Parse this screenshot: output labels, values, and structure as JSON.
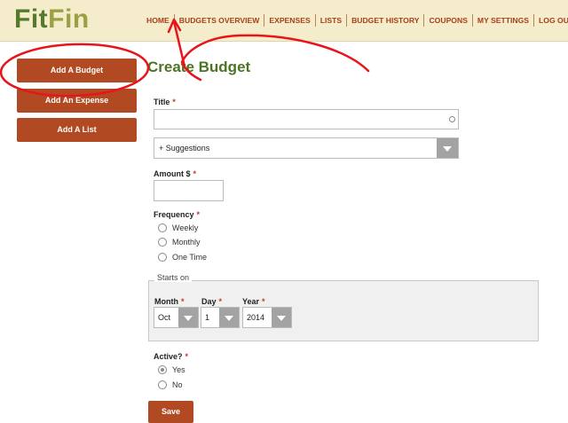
{
  "header": {
    "logo_fit": "Fit",
    "logo_fin": "Fin",
    "nav": [
      "HOME",
      "BUDGETS OVERVIEW",
      "EXPENSES",
      "LISTS",
      "BUDGET HISTORY",
      "COUPONS",
      "MY SETTINGS",
      "LOG OUT"
    ]
  },
  "sidebar": {
    "add_budget": "Add A Budget",
    "add_expense": "Add An Expense",
    "add_list": "Add A List"
  },
  "form": {
    "title_heading": "Create Budget",
    "title_label": "Title",
    "required_mark": "*",
    "title_value": "",
    "suggestions": "+ Suggestions",
    "amount_label": "Amount $",
    "amount_value": "",
    "frequency_label": "Frequency",
    "frequency_options": [
      "Weekly",
      "Monthly",
      "One Time"
    ],
    "starts_on_legend": "Starts on",
    "month_label": "Month",
    "month_value": "Oct",
    "day_label": "Day",
    "day_value": "1",
    "year_label": "Year",
    "year_value": "2014",
    "active_label": "Active?",
    "active_options": [
      "Yes",
      "No"
    ],
    "active_selected": "Yes",
    "save_label": "Save"
  },
  "colors": {
    "accent_button": "#b14a22",
    "header_bg": "#f4ecca",
    "title_green": "#4d7424",
    "annotation_red": "#e8141a"
  }
}
